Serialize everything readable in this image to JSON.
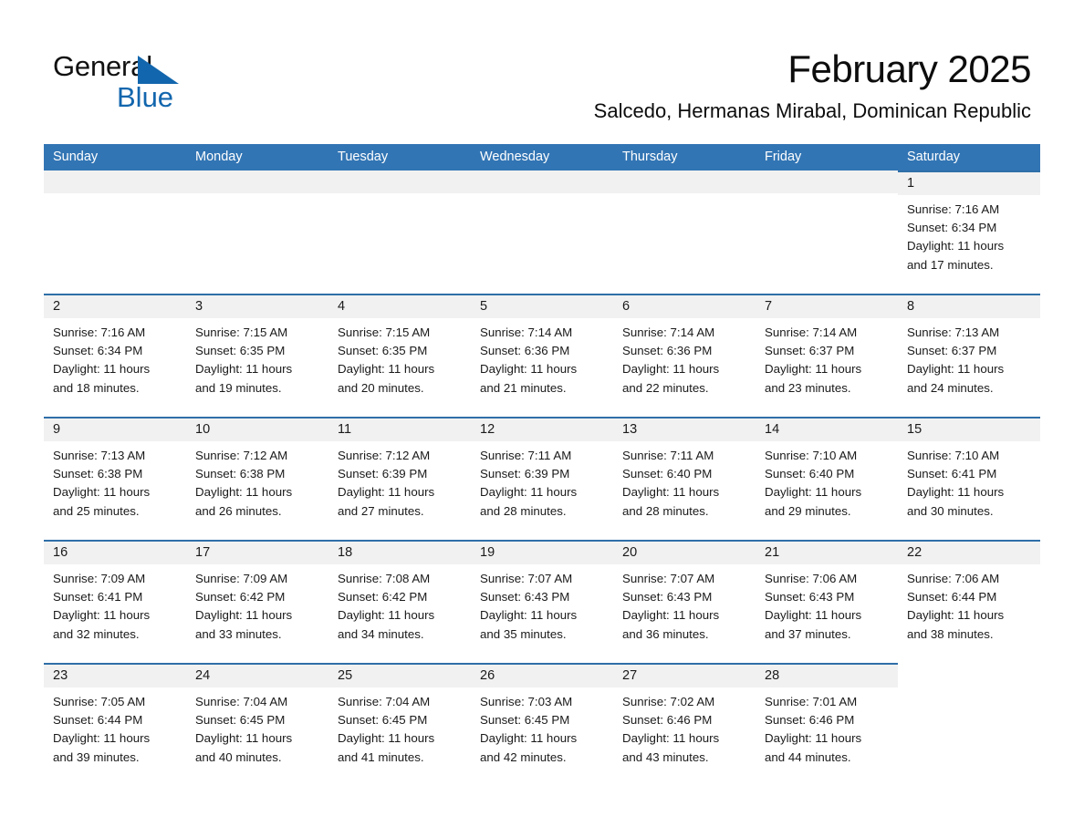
{
  "brand": {
    "name_part1": "General",
    "name_part2": "Blue",
    "triangle_color": "#1266ad",
    "text_color": "#111111"
  },
  "header": {
    "title": "February 2025",
    "subtitle": "Salcedo, Hermanas Mirabal, Dominican Republic"
  },
  "theme": {
    "header_blue": "#3275b4",
    "cell_border_blue": "#2f6fa8",
    "day_strip_gray": "#f1f1f1",
    "text": "#1a1a1a"
  },
  "weekdays": [
    "Sunday",
    "Monday",
    "Tuesday",
    "Wednesday",
    "Thursday",
    "Friday",
    "Saturday"
  ],
  "weeks": [
    {
      "days": [
        {
          "date": "",
          "blank": true,
          "lines": []
        },
        {
          "date": "",
          "blank": true,
          "lines": []
        },
        {
          "date": "",
          "blank": true,
          "lines": []
        },
        {
          "date": "",
          "blank": true,
          "lines": []
        },
        {
          "date": "",
          "blank": true,
          "lines": []
        },
        {
          "date": "",
          "blank": true,
          "lines": []
        },
        {
          "date": "1",
          "blank": false,
          "lines": [
            "Sunrise: 7:16 AM",
            "Sunset: 6:34 PM",
            "Daylight: 11 hours",
            "and 17 minutes."
          ]
        }
      ]
    },
    {
      "days": [
        {
          "date": "2",
          "blank": false,
          "lines": [
            "Sunrise: 7:16 AM",
            "Sunset: 6:34 PM",
            "Daylight: 11 hours",
            "and 18 minutes."
          ]
        },
        {
          "date": "3",
          "blank": false,
          "lines": [
            "Sunrise: 7:15 AM",
            "Sunset: 6:35 PM",
            "Daylight: 11 hours",
            "and 19 minutes."
          ]
        },
        {
          "date": "4",
          "blank": false,
          "lines": [
            "Sunrise: 7:15 AM",
            "Sunset: 6:35 PM",
            "Daylight: 11 hours",
            "and 20 minutes."
          ]
        },
        {
          "date": "5",
          "blank": false,
          "lines": [
            "Sunrise: 7:14 AM",
            "Sunset: 6:36 PM",
            "Daylight: 11 hours",
            "and 21 minutes."
          ]
        },
        {
          "date": "6",
          "blank": false,
          "lines": [
            "Sunrise: 7:14 AM",
            "Sunset: 6:36 PM",
            "Daylight: 11 hours",
            "and 22 minutes."
          ]
        },
        {
          "date": "7",
          "blank": false,
          "lines": [
            "Sunrise: 7:14 AM",
            "Sunset: 6:37 PM",
            "Daylight: 11 hours",
            "and 23 minutes."
          ]
        },
        {
          "date": "8",
          "blank": false,
          "lines": [
            "Sunrise: 7:13 AM",
            "Sunset: 6:37 PM",
            "Daylight: 11 hours",
            "and 24 minutes."
          ]
        }
      ]
    },
    {
      "days": [
        {
          "date": "9",
          "blank": false,
          "lines": [
            "Sunrise: 7:13 AM",
            "Sunset: 6:38 PM",
            "Daylight: 11 hours",
            "and 25 minutes."
          ]
        },
        {
          "date": "10",
          "blank": false,
          "lines": [
            "Sunrise: 7:12 AM",
            "Sunset: 6:38 PM",
            "Daylight: 11 hours",
            "and 26 minutes."
          ]
        },
        {
          "date": "11",
          "blank": false,
          "lines": [
            "Sunrise: 7:12 AM",
            "Sunset: 6:39 PM",
            "Daylight: 11 hours",
            "and 27 minutes."
          ]
        },
        {
          "date": "12",
          "blank": false,
          "lines": [
            "Sunrise: 7:11 AM",
            "Sunset: 6:39 PM",
            "Daylight: 11 hours",
            "and 28 minutes."
          ]
        },
        {
          "date": "13",
          "blank": false,
          "lines": [
            "Sunrise: 7:11 AM",
            "Sunset: 6:40 PM",
            "Daylight: 11 hours",
            "and 28 minutes."
          ]
        },
        {
          "date": "14",
          "blank": false,
          "lines": [
            "Sunrise: 7:10 AM",
            "Sunset: 6:40 PM",
            "Daylight: 11 hours",
            "and 29 minutes."
          ]
        },
        {
          "date": "15",
          "blank": false,
          "lines": [
            "Sunrise: 7:10 AM",
            "Sunset: 6:41 PM",
            "Daylight: 11 hours",
            "and 30 minutes."
          ]
        }
      ]
    },
    {
      "days": [
        {
          "date": "16",
          "blank": false,
          "lines": [
            "Sunrise: 7:09 AM",
            "Sunset: 6:41 PM",
            "Daylight: 11 hours",
            "and 32 minutes."
          ]
        },
        {
          "date": "17",
          "blank": false,
          "lines": [
            "Sunrise: 7:09 AM",
            "Sunset: 6:42 PM",
            "Daylight: 11 hours",
            "and 33 minutes."
          ]
        },
        {
          "date": "18",
          "blank": false,
          "lines": [
            "Sunrise: 7:08 AM",
            "Sunset: 6:42 PM",
            "Daylight: 11 hours",
            "and 34 minutes."
          ]
        },
        {
          "date": "19",
          "blank": false,
          "lines": [
            "Sunrise: 7:07 AM",
            "Sunset: 6:43 PM",
            "Daylight: 11 hours",
            "and 35 minutes."
          ]
        },
        {
          "date": "20",
          "blank": false,
          "lines": [
            "Sunrise: 7:07 AM",
            "Sunset: 6:43 PM",
            "Daylight: 11 hours",
            "and 36 minutes."
          ]
        },
        {
          "date": "21",
          "blank": false,
          "lines": [
            "Sunrise: 7:06 AM",
            "Sunset: 6:43 PM",
            "Daylight: 11 hours",
            "and 37 minutes."
          ]
        },
        {
          "date": "22",
          "blank": false,
          "lines": [
            "Sunrise: 7:06 AM",
            "Sunset: 6:44 PM",
            "Daylight: 11 hours",
            "and 38 minutes."
          ]
        }
      ]
    },
    {
      "days": [
        {
          "date": "23",
          "blank": false,
          "lines": [
            "Sunrise: 7:05 AM",
            "Sunset: 6:44 PM",
            "Daylight: 11 hours",
            "and 39 minutes."
          ]
        },
        {
          "date": "24",
          "blank": false,
          "lines": [
            "Sunrise: 7:04 AM",
            "Sunset: 6:45 PM",
            "Daylight: 11 hours",
            "and 40 minutes."
          ]
        },
        {
          "date": "25",
          "blank": false,
          "lines": [
            "Sunrise: 7:04 AM",
            "Sunset: 6:45 PM",
            "Daylight: 11 hours",
            "and 41 minutes."
          ]
        },
        {
          "date": "26",
          "blank": false,
          "lines": [
            "Sunrise: 7:03 AM",
            "Sunset: 6:45 PM",
            "Daylight: 11 hours",
            "and 42 minutes."
          ]
        },
        {
          "date": "27",
          "blank": false,
          "lines": [
            "Sunrise: 7:02 AM",
            "Sunset: 6:46 PM",
            "Daylight: 11 hours",
            "and 43 minutes."
          ]
        },
        {
          "date": "28",
          "blank": false,
          "lines": [
            "Sunrise: 7:01 AM",
            "Sunset: 6:46 PM",
            "Daylight: 11 hours",
            "and 44 minutes."
          ]
        },
        {
          "date": "",
          "blank": true,
          "trailing": true,
          "lines": []
        }
      ]
    }
  ]
}
